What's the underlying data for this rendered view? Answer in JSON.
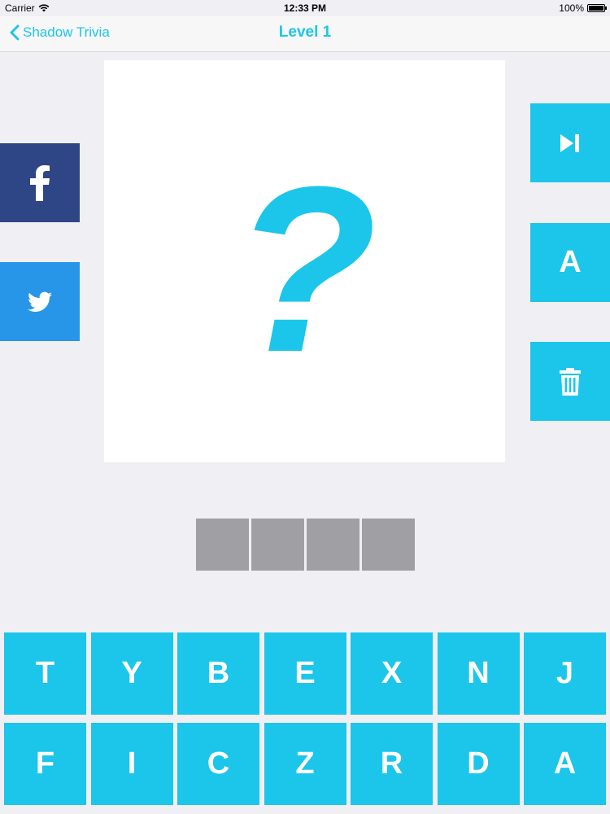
{
  "status_bar": {
    "carrier": "Carrier",
    "time": "12:33 PM",
    "battery": "100%"
  },
  "nav": {
    "back_label": "Shadow Trivia",
    "title": "Level 1"
  },
  "puzzle": {
    "glyph": "?"
  },
  "actions": {
    "reveal_label": "A"
  },
  "answer": {
    "slot_count": 4
  },
  "keyboard": {
    "keys": [
      "T",
      "Y",
      "B",
      "E",
      "X",
      "N",
      "J",
      "F",
      "I",
      "C",
      "Z",
      "R",
      "D",
      "A"
    ]
  },
  "colors": {
    "accent": "#1bc6ea",
    "facebook": "#2f4686",
    "twitter": "#2796e9",
    "slot": "#a09fa3",
    "background": "#efeff4"
  },
  "icons": {
    "back": "chevron-left-icon",
    "facebook": "facebook-icon",
    "twitter": "twitter-icon",
    "skip": "skip-icon",
    "remove": "trash-icon",
    "wifi": "wifi-icon",
    "battery": "battery-icon"
  }
}
